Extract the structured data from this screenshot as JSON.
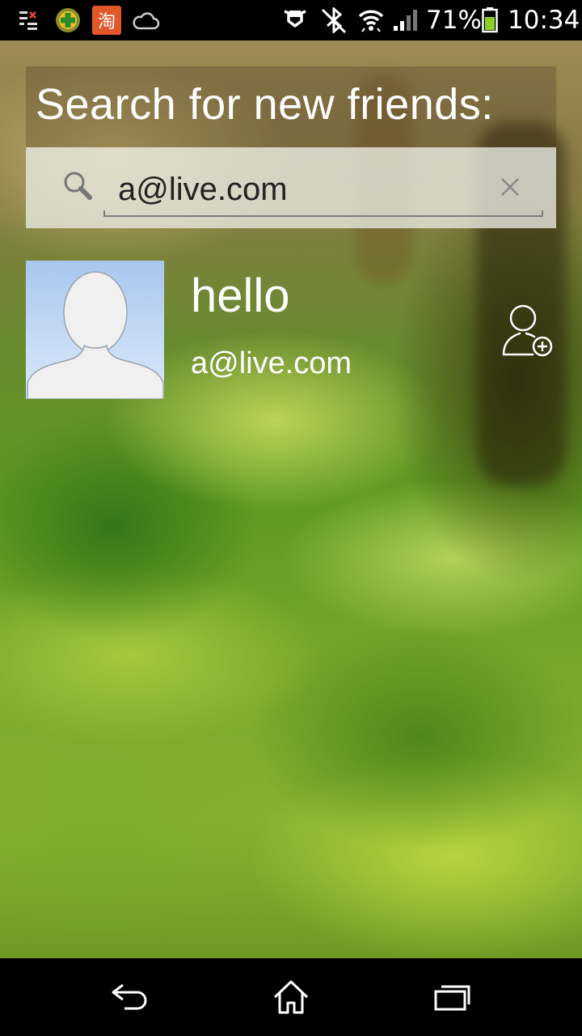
{
  "status_bar": {
    "battery_percent": "71%",
    "time": "10:34",
    "icons": [
      "sim-toolkit-icon",
      "app-green-icon",
      "taobao-icon",
      "cloud-icon",
      "nfc-icon",
      "bluetooth-off-icon",
      "wifi-icon",
      "signal-icon",
      "battery-icon"
    ],
    "taobao_glyph": "淘"
  },
  "search": {
    "title": "Search for new friends:",
    "value": "a@live.com"
  },
  "result": {
    "name": "hello",
    "email": "a@live.com"
  },
  "nav": {
    "buttons": [
      "back-button",
      "home-button",
      "recent-apps-button"
    ]
  }
}
